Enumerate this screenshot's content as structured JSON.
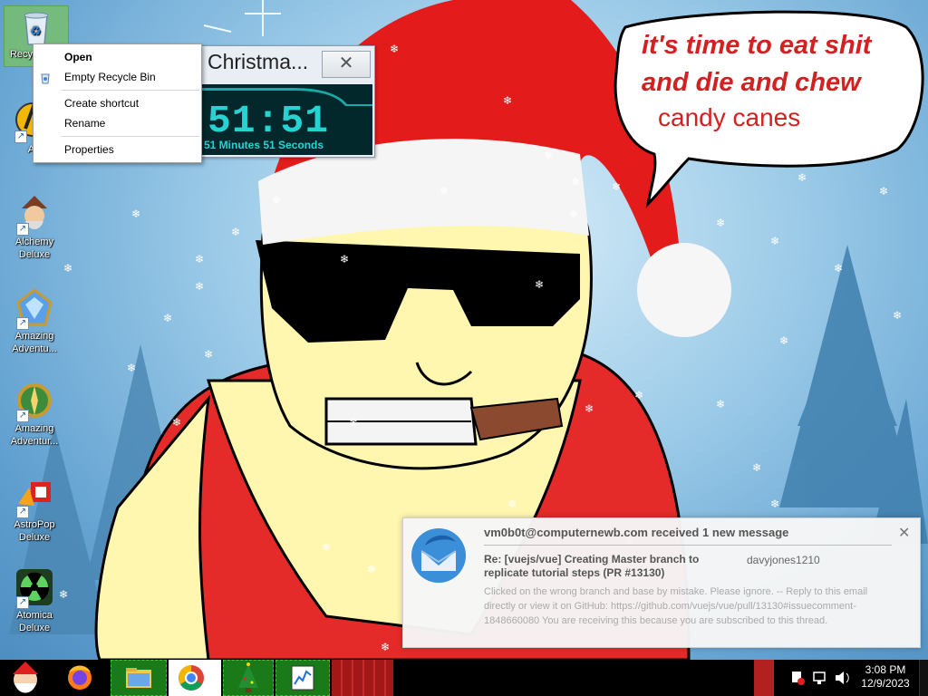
{
  "desktop": {
    "icons": [
      {
        "label": "Recycle Bin",
        "icon": "recycle-bin-icon"
      },
      {
        "label": "AI",
        "icon": "ai-app-icon"
      },
      {
        "label": "Alchemy Deluxe",
        "icon": "wizard-icon"
      },
      {
        "label": "Amazing Adventu...",
        "icon": "gem-icon"
      },
      {
        "label": "Amazing Adventur...",
        "icon": "compass-icon"
      },
      {
        "label": "AstroPop Deluxe",
        "icon": "astropop-icon"
      },
      {
        "label": "Atomica Deluxe",
        "icon": "radiation-icon"
      }
    ]
  },
  "context_menu": {
    "items": [
      "Open",
      "Empty Recycle Bin",
      "Create shortcut",
      "Rename",
      "Properties"
    ]
  },
  "countdown": {
    "title": "Christma...",
    "time": "51:51",
    "subtitle": "51 Minutes 51 Seconds",
    "close_glyph": "✕"
  },
  "speech_bubble": {
    "line1": "it's time to eat shit",
    "line2": "and die and chew",
    "line3": "candy canes",
    "accent": "#d42020"
  },
  "notification": {
    "header": "vm0b0t@computernewb.com received 1 new message",
    "subject": "Re: [vuejs/vue] Creating Master branch to replicate tutorial steps (PR #13130)",
    "from": "davyjones1210",
    "body": "Clicked on the wrong branch and base by mistake. Please ignore. -- Reply to this email directly or view it on GitHub: https://github.com/vuejs/vue/pull/13130#issuecomment-1848660080 You are receiving this because you are subscribed to this thread.",
    "close_glyph": "✕"
  },
  "taskbar": {
    "apps": [
      "start-santa-icon",
      "firefox-icon",
      "file-explorer-icon",
      "chrome-icon",
      "christmas-tree-icon",
      "notepad-chart-icon"
    ],
    "clock_time": "3:08 PM",
    "clock_date": "12/9/2023"
  }
}
